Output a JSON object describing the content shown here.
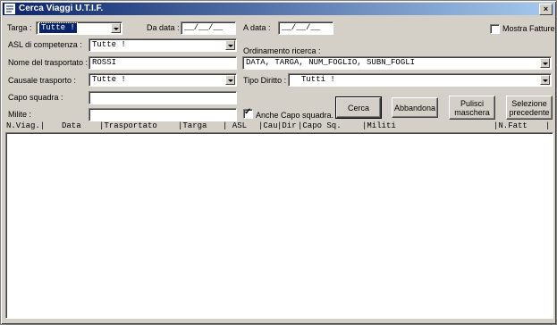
{
  "window": {
    "title": "Cerca Viaggi U.T.I.F.",
    "close_glyph": "×"
  },
  "filters": {
    "targa": {
      "label": "Targa :",
      "value": "Tutte !"
    },
    "da_data": {
      "label": "Da data :",
      "value": "__/__/__"
    },
    "a_data": {
      "label": "A data :",
      "value": "__/__/__"
    },
    "mostra_fatture": {
      "label": "Mostra Fatture",
      "checked": false
    },
    "asl": {
      "label": "ASL di competenza :",
      "value": "Tutte !"
    },
    "trasportato": {
      "label": "Nome del trasportato :",
      "value": "ROSSI"
    },
    "causale": {
      "label": "Causale trasporto :",
      "value": "Tutte !"
    },
    "capo_squadra": {
      "label": "Capo squadra :",
      "value": ""
    },
    "milite": {
      "label": "Milite :",
      "value": ""
    },
    "anche_capo": {
      "label": "Anche Capo squadra.",
      "checked": true
    },
    "ordinamento": {
      "label": "Ordinamento ricerca :",
      "value": "DATA, TARGA, NUM_FOGLIO, SUBN_FOGLI"
    },
    "tipo_diritto": {
      "label": "Tipo Diritto :",
      "value": "Tutti !"
    }
  },
  "buttons": {
    "cerca": "Cerca",
    "abbandona": "Abbandona",
    "pulisci_1": "Pulisci",
    "pulisci_2": "maschera",
    "selezione_1": "Selezione",
    "selezione_2": "precedente"
  },
  "table": {
    "columns": [
      "N.Viag.|",
      "Data",
      "|Trasportato",
      "|Targa",
      "|  ASL",
      "|Cau",
      "|Dir",
      "|Capo Sq.",
      "|Militi",
      "|N.Fatt",
      "|"
    ],
    "rows": []
  }
}
